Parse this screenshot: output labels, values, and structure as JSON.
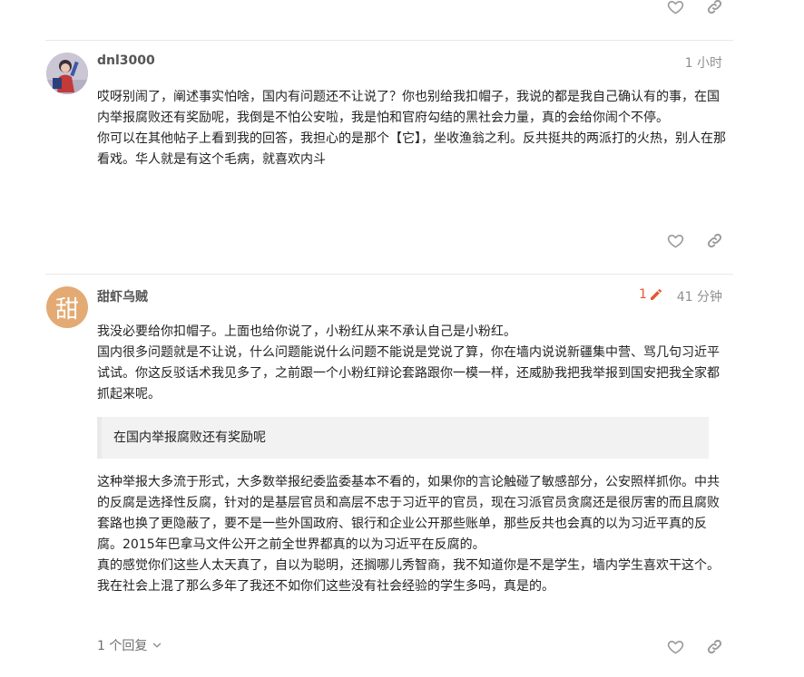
{
  "posts": [
    {
      "username": "dnl3000",
      "time": "1 小时",
      "paragraphs": [
        "哎呀别闹了，阐述事实怕啥，国内有问题还不让说了？你也别给我扣帽子，我说的都是我自己确认有的事，在国内举报腐败还有奖励呢，我倒是不怕公安啦，我是怕和官府勾结的黑社会力量，真的会给你闹个不停。",
        "你可以在其他帖子上看到我的回答，我担心的是那个【它】，坐收渔翁之利。反共挺共的两派打的火热，别人在那看戏。华人就是有这个毛病，就喜欢内斗"
      ]
    },
    {
      "username": "甜虾乌贼",
      "avatar_letter": "甜",
      "avatar_color": "#e3aa74",
      "edit_count": "1",
      "time": "41 分钟",
      "paragraphs_before_quote": [
        "我没必要给你扣帽子。上面也给你说了，小粉红从来不承认自己是小粉红。",
        "国内很多问题就是不让说，什么问题能说什么问题不能说是党说了算，你在墙内说说新疆集中营、骂几句习近平试试。你这反驳话术我见多了，之前跟一个小粉红辩论套路跟你一模一样，还威胁我把我举报到国安把我全家都抓起来呢。"
      ],
      "quote": "在国内举报腐败还有奖励呢",
      "paragraphs_after_quote": [
        "这种举报大多流于形式，大多数举报纪委监委基本不看的，如果你的言论触碰了敏感部分，公安照样抓你。中共的反腐是选择性反腐，针对的是基层官员和高层不忠于习近平的官员，现在习派官员贪腐还是很厉害的而且腐败套路也换了更隐蔽了，要不是一些外国政府、银行和企业公开那些账单，那些反共也会真的以为习近平真的反腐。2015年巴拿马文件公开之前全世界都真的以为习近平在反腐的。",
        "真的感觉你们这些人太天真了，自以为聪明，还搁哪儿秀智商，我不知道你是不是学生，墙内学生喜欢干这个。我在社会上混了那么多年了我还不如你们这些没有社会经验的学生多吗，真是的。"
      ],
      "replies_label": "1 个回复"
    }
  ],
  "icons": {
    "like": "heart-outline-icon",
    "share": "link-icon",
    "edit": "pencil-icon",
    "expand": "chevron-down-icon"
  },
  "colors": {
    "accent": "#e45735",
    "meta": "#8f8f8f",
    "quote_bg": "#f2f2f2"
  }
}
